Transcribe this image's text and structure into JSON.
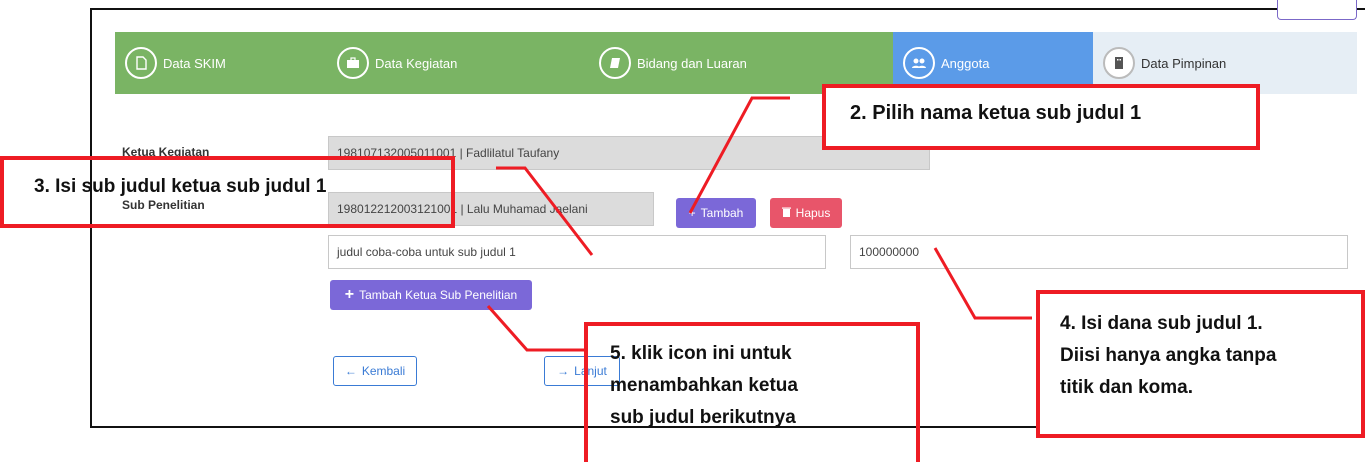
{
  "wizard": {
    "steps": [
      {
        "label": "Data SKIM",
        "icon": "document-icon"
      },
      {
        "label": "Data Kegiatan",
        "icon": "briefcase-icon"
      },
      {
        "label": "Bidang dan Luaran",
        "icon": "book-icon"
      },
      {
        "label": "Anggota",
        "icon": "users-icon"
      },
      {
        "label": "Data Pimpinan",
        "icon": "building-icon"
      }
    ],
    "active_step": "Anggota"
  },
  "form": {
    "ketua_label": "Ketua Kegiatan",
    "ketua_value": "198107132005011001 | Fadlilatul Taufany",
    "sub_label": "Sub Penelitian",
    "sub_ketua_value": "198012212003121001 | Lalu Muhamad Jaelani",
    "sub_judul_value": "judul coba-coba untuk sub judul 1",
    "sub_dana_value": "100000000",
    "tambah_label": "Tambah",
    "hapus_label": "Hapus",
    "tambah_ketua_label": "Tambah Ketua Sub Penelitian",
    "kembali_label": "Kembali",
    "lanjut_label": "Lanjut"
  },
  "callouts": {
    "c2": "2.  Pilih nama ketua sub judul 1",
    "c3": "3. Isi sub judul ketua sub judul 1",
    "c4_l1": "4. Isi dana sub judul 1.",
    "c4_l2": "Diisi hanya angka tanpa",
    "c4_l3": "titik dan koma.",
    "c5_l1": "5. klik icon ini untuk",
    "c5_l2": "menambahkan ketua",
    "c5_l3": "sub judul berikutnya"
  },
  "colors": {
    "step_green": "#7ab464",
    "step_active": "#5b9be8",
    "button_purple": "#7b68d8",
    "button_red": "#e8556a",
    "callout_red": "#ee1c24"
  }
}
